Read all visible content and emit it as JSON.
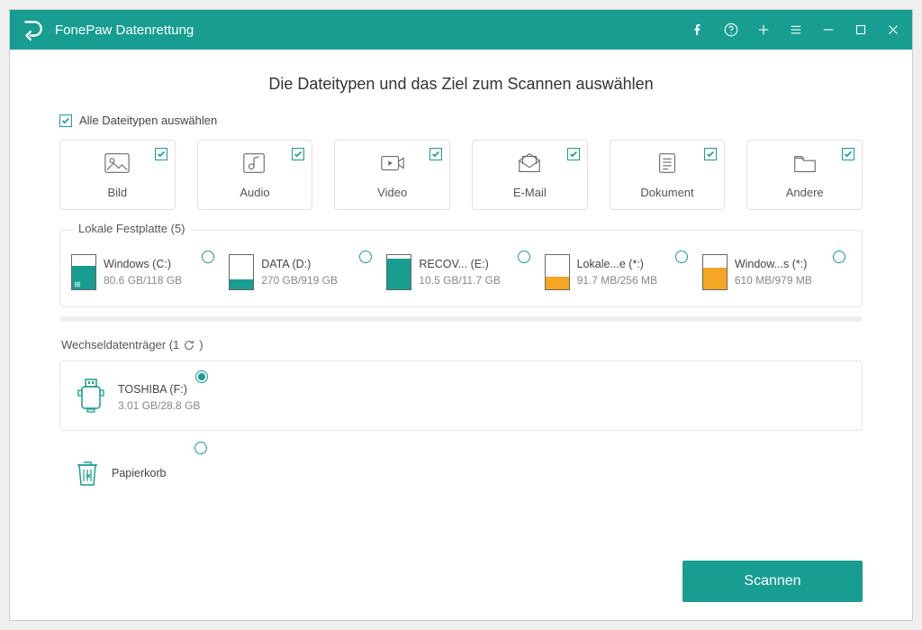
{
  "app": {
    "title": "FonePaw Datenrettung"
  },
  "heading": "Die Dateitypen und das Ziel zum Scannen auswählen",
  "select_all_label": "Alle Dateitypen auswählen",
  "cards": [
    {
      "label": "Bild"
    },
    {
      "label": "Audio"
    },
    {
      "label": "Video"
    },
    {
      "label": "E-Mail"
    },
    {
      "label": "Dokument"
    },
    {
      "label": "Andere"
    }
  ],
  "local_group_label": "Lokale Festplatte (5)",
  "drives": [
    {
      "name": "Windows (C:)",
      "size": "80.6 GB/118 GB",
      "fill": 68,
      "color": "teal",
      "win": true
    },
    {
      "name": "DATA (D:)",
      "size": "270 GB/919 GB",
      "fill": 30,
      "color": "teal",
      "win": false
    },
    {
      "name": "RECOV... (E:)",
      "size": "10.5 GB/11.7 GB",
      "fill": 90,
      "color": "teal",
      "win": false
    },
    {
      "name": "Lokale...e (*:)",
      "size": "91.7 MB/256 MB",
      "fill": 36,
      "color": "orange",
      "win": false
    },
    {
      "name": "Window...s (*:)",
      "size": "610 MB/979 MB",
      "fill": 62,
      "color": "orange",
      "win": false
    }
  ],
  "removable_label": "Wechseldatenträger (1",
  "removable_drive": {
    "name": "TOSHIBA (F:)",
    "size": "3.01 GB/28.8 GB"
  },
  "recycle_label": "Papierkorb",
  "scan_label": "Scannen"
}
